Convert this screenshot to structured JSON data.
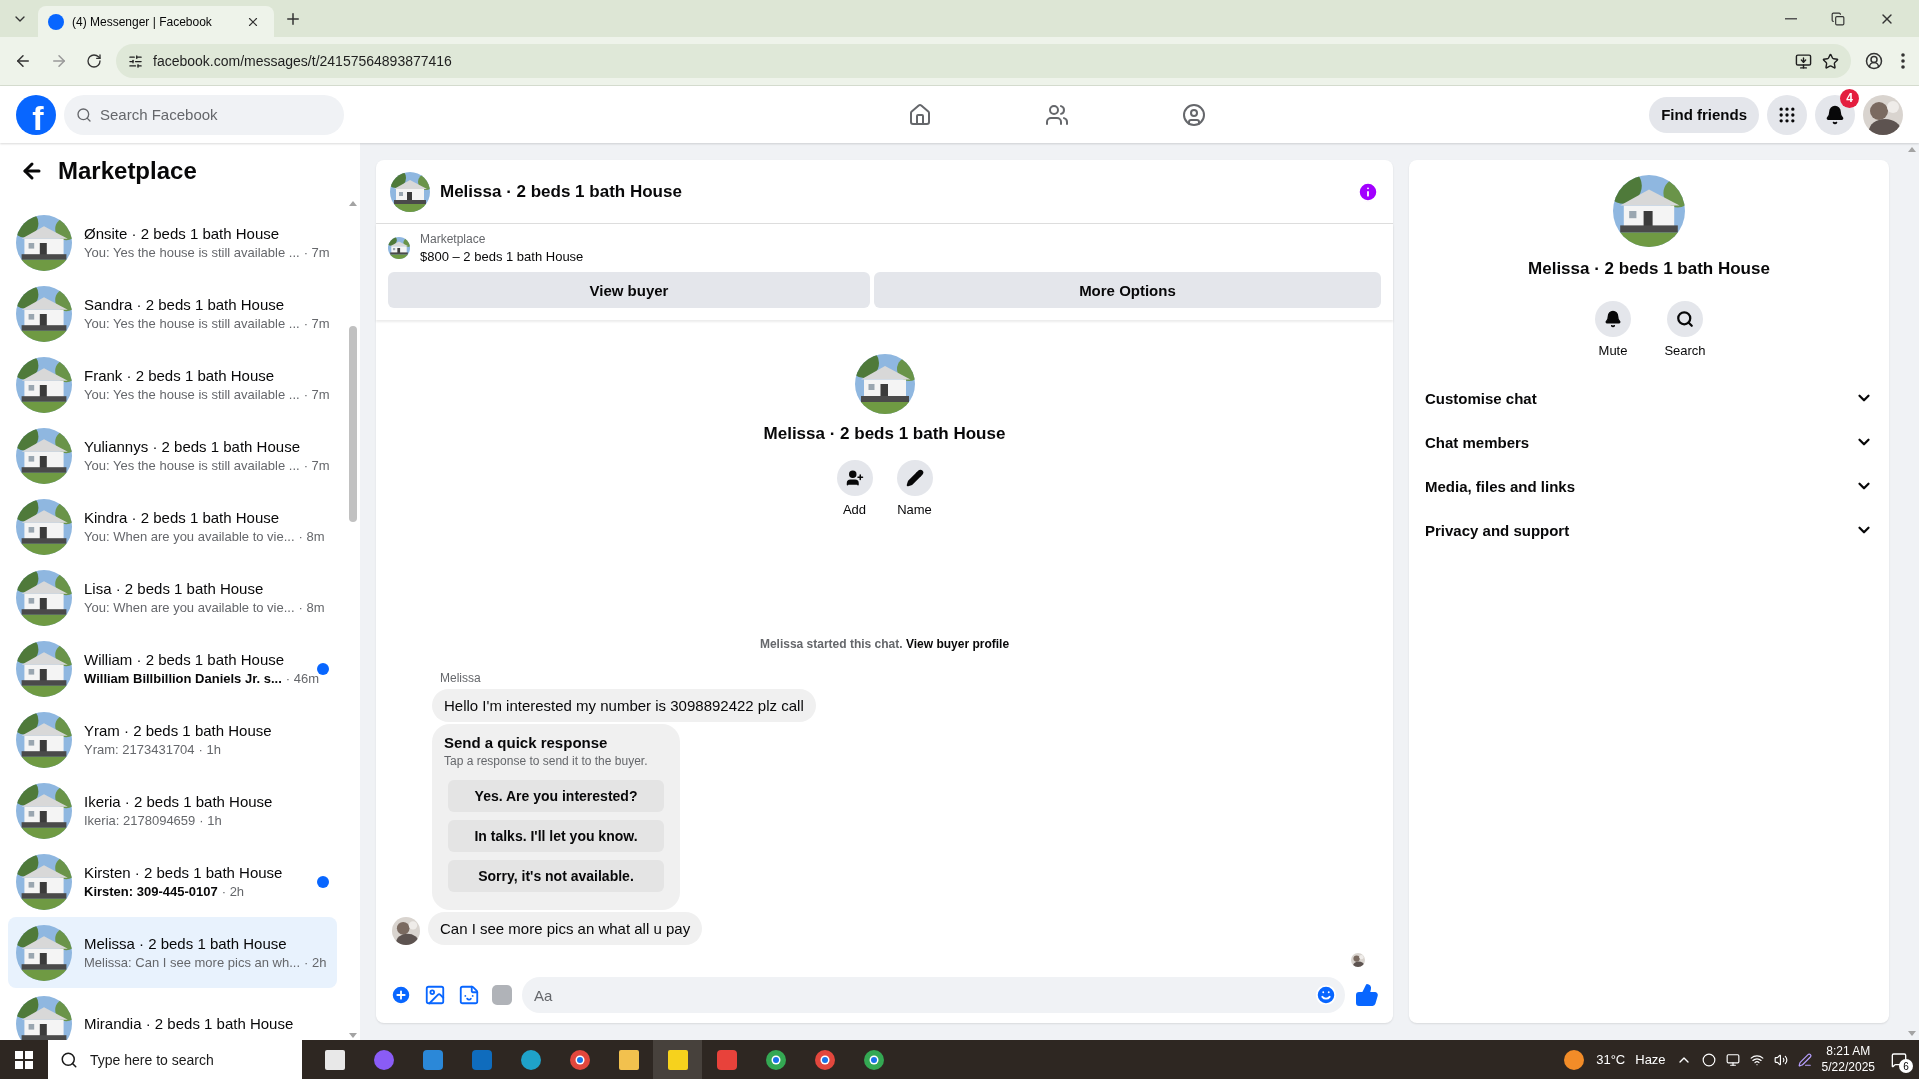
{
  "browser": {
    "tab_title": "(4) Messenger | Facebook",
    "url": "facebook.com/messages/t/24157564893877416"
  },
  "header": {
    "logo_letter": "f",
    "search_placeholder": "Search Facebook",
    "find_friends": "Find friends",
    "notification_count": "4"
  },
  "sidebar": {
    "title": "Marketplace",
    "conversations": [
      {
        "title": "Ønsite · 2 beds 1 bath House",
        "preview": "You: Yes the house is still available ...",
        "time": "· 7m",
        "unread": false,
        "selected": false
      },
      {
        "title": "Sandra · 2 beds 1 bath House",
        "preview": "You: Yes the house is still available ...",
        "time": "· 7m",
        "unread": false,
        "selected": false
      },
      {
        "title": "Frank · 2 beds 1 bath House",
        "preview": "You: Yes the house is still available ...",
        "time": "· 7m",
        "unread": false,
        "selected": false
      },
      {
        "title": "Yuliannys · 2 beds 1 bath House",
        "preview": "You: Yes the house is still available ...",
        "time": "· 7m",
        "unread": false,
        "selected": false
      },
      {
        "title": "Kindra · 2 beds 1 bath House",
        "preview": "You: When are you available to vie...",
        "time": "· 8m",
        "unread": false,
        "selected": false
      },
      {
        "title": "Lisa · 2 beds 1 bath House",
        "preview": "You: When are you available to vie...",
        "time": "· 8m",
        "unread": false,
        "selected": false
      },
      {
        "title": "William · 2 beds 1 bath House",
        "preview": "William Billbillion Daniels Jr. s...",
        "time": "· 46m",
        "unread": true,
        "selected": false
      },
      {
        "title": "Yram · 2 beds 1 bath House",
        "preview": "Yram: 2173431704",
        "time": "· 1h",
        "unread": false,
        "selected": false
      },
      {
        "title": "Ikeria · 2 beds 1 bath House",
        "preview": "Ikeria: 2178094659",
        "time": "· 1h",
        "unread": false,
        "selected": false
      },
      {
        "title": "Kirsten · 2 beds 1 bath House",
        "preview": "Kirsten: 309-445-0107",
        "time": "· 2h",
        "unread": true,
        "selected": false
      },
      {
        "title": "Melissa · 2 beds 1 bath House",
        "preview": "Melissa: Can I see more pics an wh...",
        "time": "· 2h",
        "unread": false,
        "selected": true
      },
      {
        "title": "Mirandia · 2 beds 1 bath House",
        "unread": false,
        "selected": false
      }
    ]
  },
  "chat": {
    "title": "Melissa · 2 beds 1 bath House",
    "listing": {
      "source": "Marketplace",
      "item": "$800 – 2 beds 1 bath House"
    },
    "actions": [
      "View buyer",
      "More Options"
    ],
    "profile": {
      "name": "Melissa · 2 beds 1 bath House",
      "actions": [
        "Add",
        "Name"
      ]
    },
    "started": {
      "text": "Melissa started this chat.",
      "link": "View buyer profile"
    },
    "sender": "Melissa",
    "messages": [
      {
        "kind": "text",
        "text": "Hello I'm interested my number is 3098892422 plz call",
        "show_avatar": false
      },
      {
        "kind": "quick_response",
        "title": "Send a quick response",
        "subtitle": "Tap a response to send it to the buyer.",
        "options": [
          "Yes. Are you interested?",
          "In talks. I'll let you know.",
          "Sorry, it's not available."
        ]
      },
      {
        "kind": "text",
        "text": "Can I see more pics an what all u pay",
        "show_avatar": true
      }
    ],
    "composer": {
      "placeholder": "Aa"
    }
  },
  "details": {
    "name": "Melissa · 2 beds 1 bath House",
    "actions": [
      "Mute",
      "Search"
    ],
    "sections": [
      {
        "label": "Customise chat",
        "expanded": false
      },
      {
        "label": "Chat members",
        "expanded": false
      },
      {
        "label": "Media, files and links",
        "expanded": false
      },
      {
        "label": "Privacy and support",
        "expanded": false
      }
    ]
  },
  "taskbar": {
    "search_placeholder": "Type here to search",
    "temperature": "31°C",
    "condition": "Haze",
    "time": "8:21 AM",
    "date": "5/22/2025",
    "notification_count": "6"
  }
}
